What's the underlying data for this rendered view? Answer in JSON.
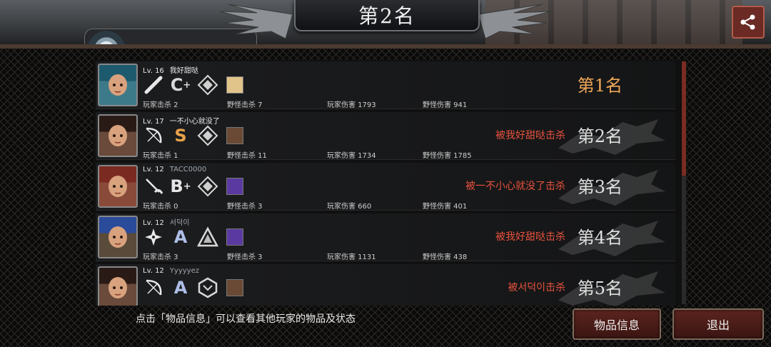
{
  "header": {
    "title": "第2名",
    "partial_label": "…"
  },
  "share_icon": "share-icon",
  "players": [
    {
      "level": "Lv. 16",
      "name": "我好甜哒",
      "name_dim": false,
      "weapon_icon": "bat-icon",
      "grade": "C",
      "grade_plus": "+",
      "grade_class": "gC",
      "armor_icon": "diamond-armor-icon",
      "item_icon": "item-scroll-icon",
      "item_color": "#e1c48a",
      "player_kills_label": "玩家击杀 2",
      "monster_kills_label": "野怪击杀 7",
      "player_damage_label": "玩家伤害 1793",
      "monster_damage_label": "野怪伤害 941",
      "killed_by": "",
      "rank": "第1名",
      "avatar_color": "#3d7a89",
      "avatar_hair": "#1e5a6e"
    },
    {
      "level": "Lv. 17",
      "name": "一不小心就没了",
      "name_dim": false,
      "weapon_icon": "bow-icon",
      "grade": "S",
      "grade_plus": "",
      "grade_class": "gS",
      "armor_icon": "diamond-armor-icon",
      "item_icon": "item-trap-icon",
      "item_color": "#6a4a35",
      "player_kills_label": "玩家击杀 1",
      "monster_kills_label": "野怪击杀 11",
      "player_damage_label": "玩家伤害 1734",
      "monster_damage_label": "野怪伤害 1785",
      "killed_by": "被我好甜哒击杀",
      "rank": "第2名",
      "avatar_color": "#6a4a3a",
      "avatar_hair": "#2a1a15"
    },
    {
      "level": "Lv. 12",
      "name": "TACC0000",
      "name_dim": true,
      "weapon_icon": "sickle-icon",
      "grade": "B",
      "grade_plus": "+",
      "grade_class": "gB",
      "armor_icon": "diamond-armor-icon",
      "item_icon": "item-cat-icon",
      "item_color": "#5a3aa0",
      "player_kills_label": "玩家击杀 0",
      "monster_kills_label": "野怪击杀 3",
      "player_damage_label": "玩家伤害 660",
      "monster_damage_label": "野怪伤害 401",
      "killed_by": "被一不小心就没了击杀",
      "rank": "第3名",
      "avatar_color": "#8a4a3a",
      "avatar_hair": "#7a2a20"
    },
    {
      "level": "Lv. 12",
      "name": "서덕이",
      "name_dim": true,
      "weapon_icon": "shuriken-icon",
      "grade": "A",
      "grade_plus": "",
      "grade_class": "gA",
      "armor_icon": "triangle-armor-icon",
      "item_icon": "item-cat-icon",
      "item_color": "#5a3aa0",
      "player_kills_label": "玩家击杀 3",
      "monster_kills_label": "野怪击杀 3",
      "player_damage_label": "玩家伤害 1131",
      "monster_damage_label": "野怪伤害 438",
      "killed_by": "被我好甜哒击杀",
      "rank": "第4名",
      "avatar_color": "#5a4a3a",
      "avatar_hair": "#2a4a9a"
    },
    {
      "level": "Lv. 12",
      "name": "Yyyyyez",
      "name_dim": true,
      "weapon_icon": "bow-icon",
      "grade": "A",
      "grade_plus": "",
      "grade_class": "gA",
      "armor_icon": "hex-armor-icon",
      "item_icon": "item-trap-icon",
      "item_color": "#6a4a35",
      "player_kills_label": "",
      "monster_kills_label": "",
      "player_damage_label": "",
      "monster_damage_label": "",
      "killed_by": "被서덕이击杀",
      "rank": "第5名",
      "avatar_color": "#6a4a3a",
      "avatar_hair": "#2a1a15"
    }
  ],
  "footer": {
    "hint": "点击「物品信息」可以查看其他玩家的物品及状态",
    "items_button": "物品信息",
    "exit_button": "退出"
  }
}
